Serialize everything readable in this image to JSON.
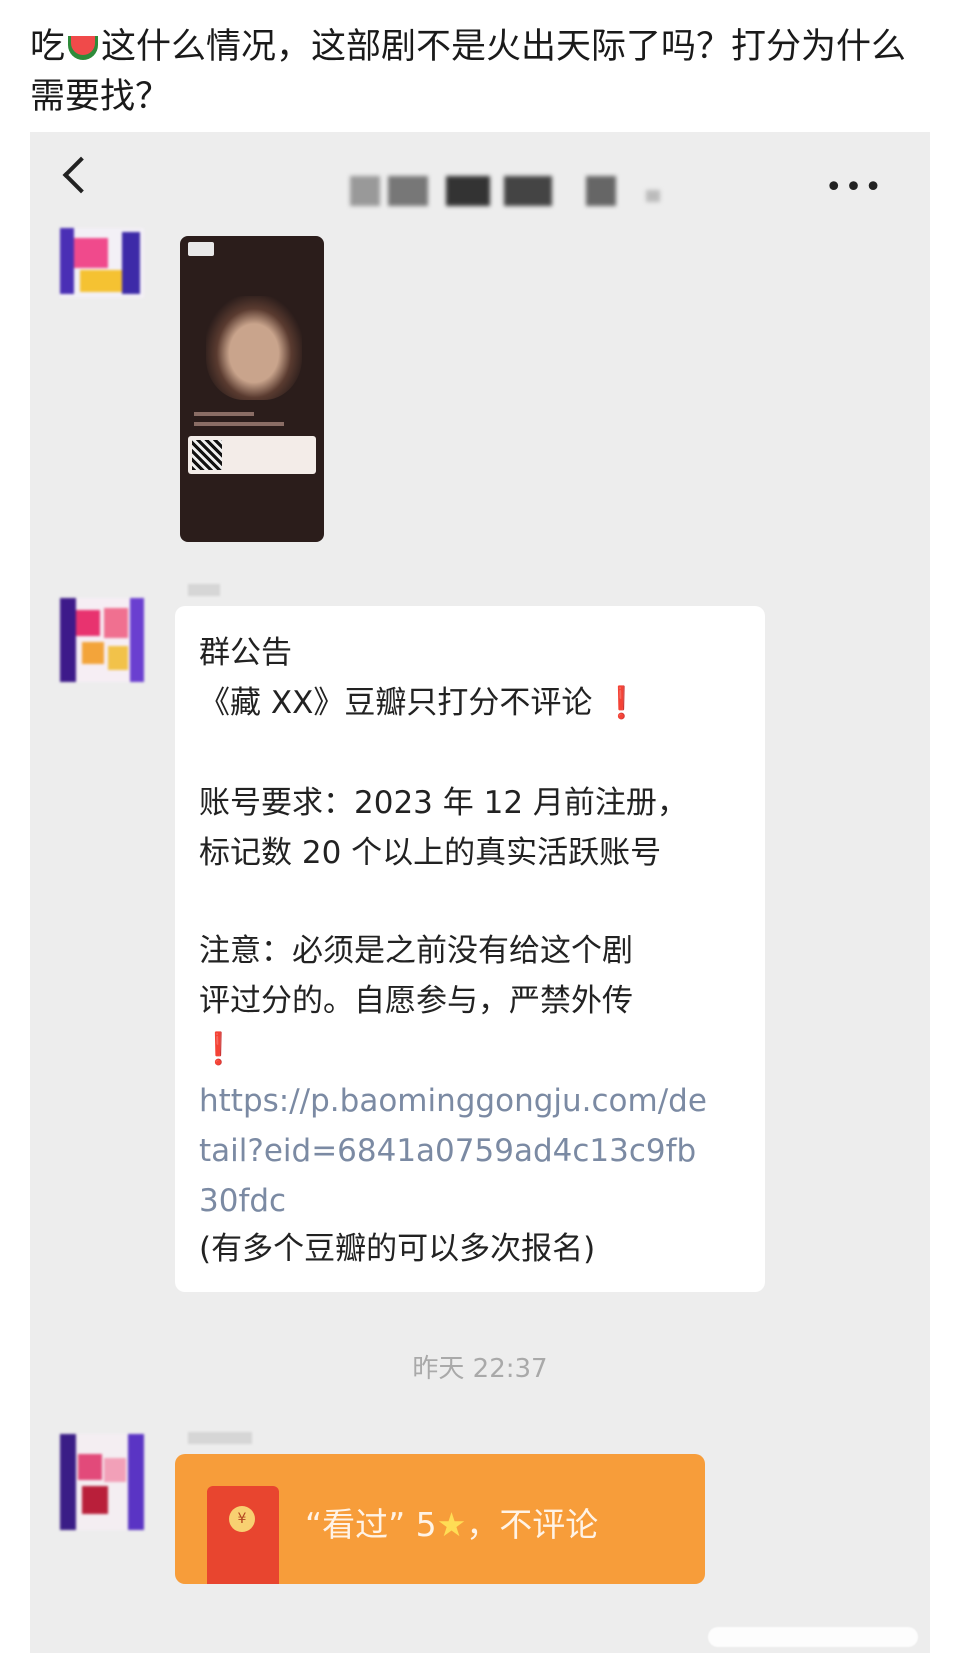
{
  "post": {
    "text_before": "吃",
    "emoji": "watermelon-emoji",
    "text_after": "这什么情况，这部剧不是火出天际了吗？打分为什么需要找？"
  },
  "chat": {
    "more_label": "•••",
    "announcement": {
      "title": "群公告",
      "line1": "《藏 XX》豆瓣只打分不评论",
      "bang": "❗",
      "req1": "账号要求：2023 年 12 月前注册，",
      "req2": "标记数 20 个以上的真实活跃账号",
      "note1": "注意：必须是之前没有给这个剧",
      "note2": "评过分的。自愿参与，严禁外传",
      "link1": "https://p.baominggongju.com/de",
      "link2": "tail?eid=6841a0759ad4c13c9fb",
      "link3": "30fdc",
      "footer": "(有多个豆瓣的可以多次报名)"
    },
    "timestamp": "昨天 22:37",
    "red_packet": {
      "coin": "¥",
      "text_pre": "“看过” 5",
      "star": "★",
      "text_post": "，不评论"
    }
  },
  "colors": {
    "chat_bg": "#ededed",
    "bubble_bg": "#ffffff",
    "red_packet": "#f79d3a",
    "link": "#7b8aa3",
    "alert": "#e02020"
  }
}
